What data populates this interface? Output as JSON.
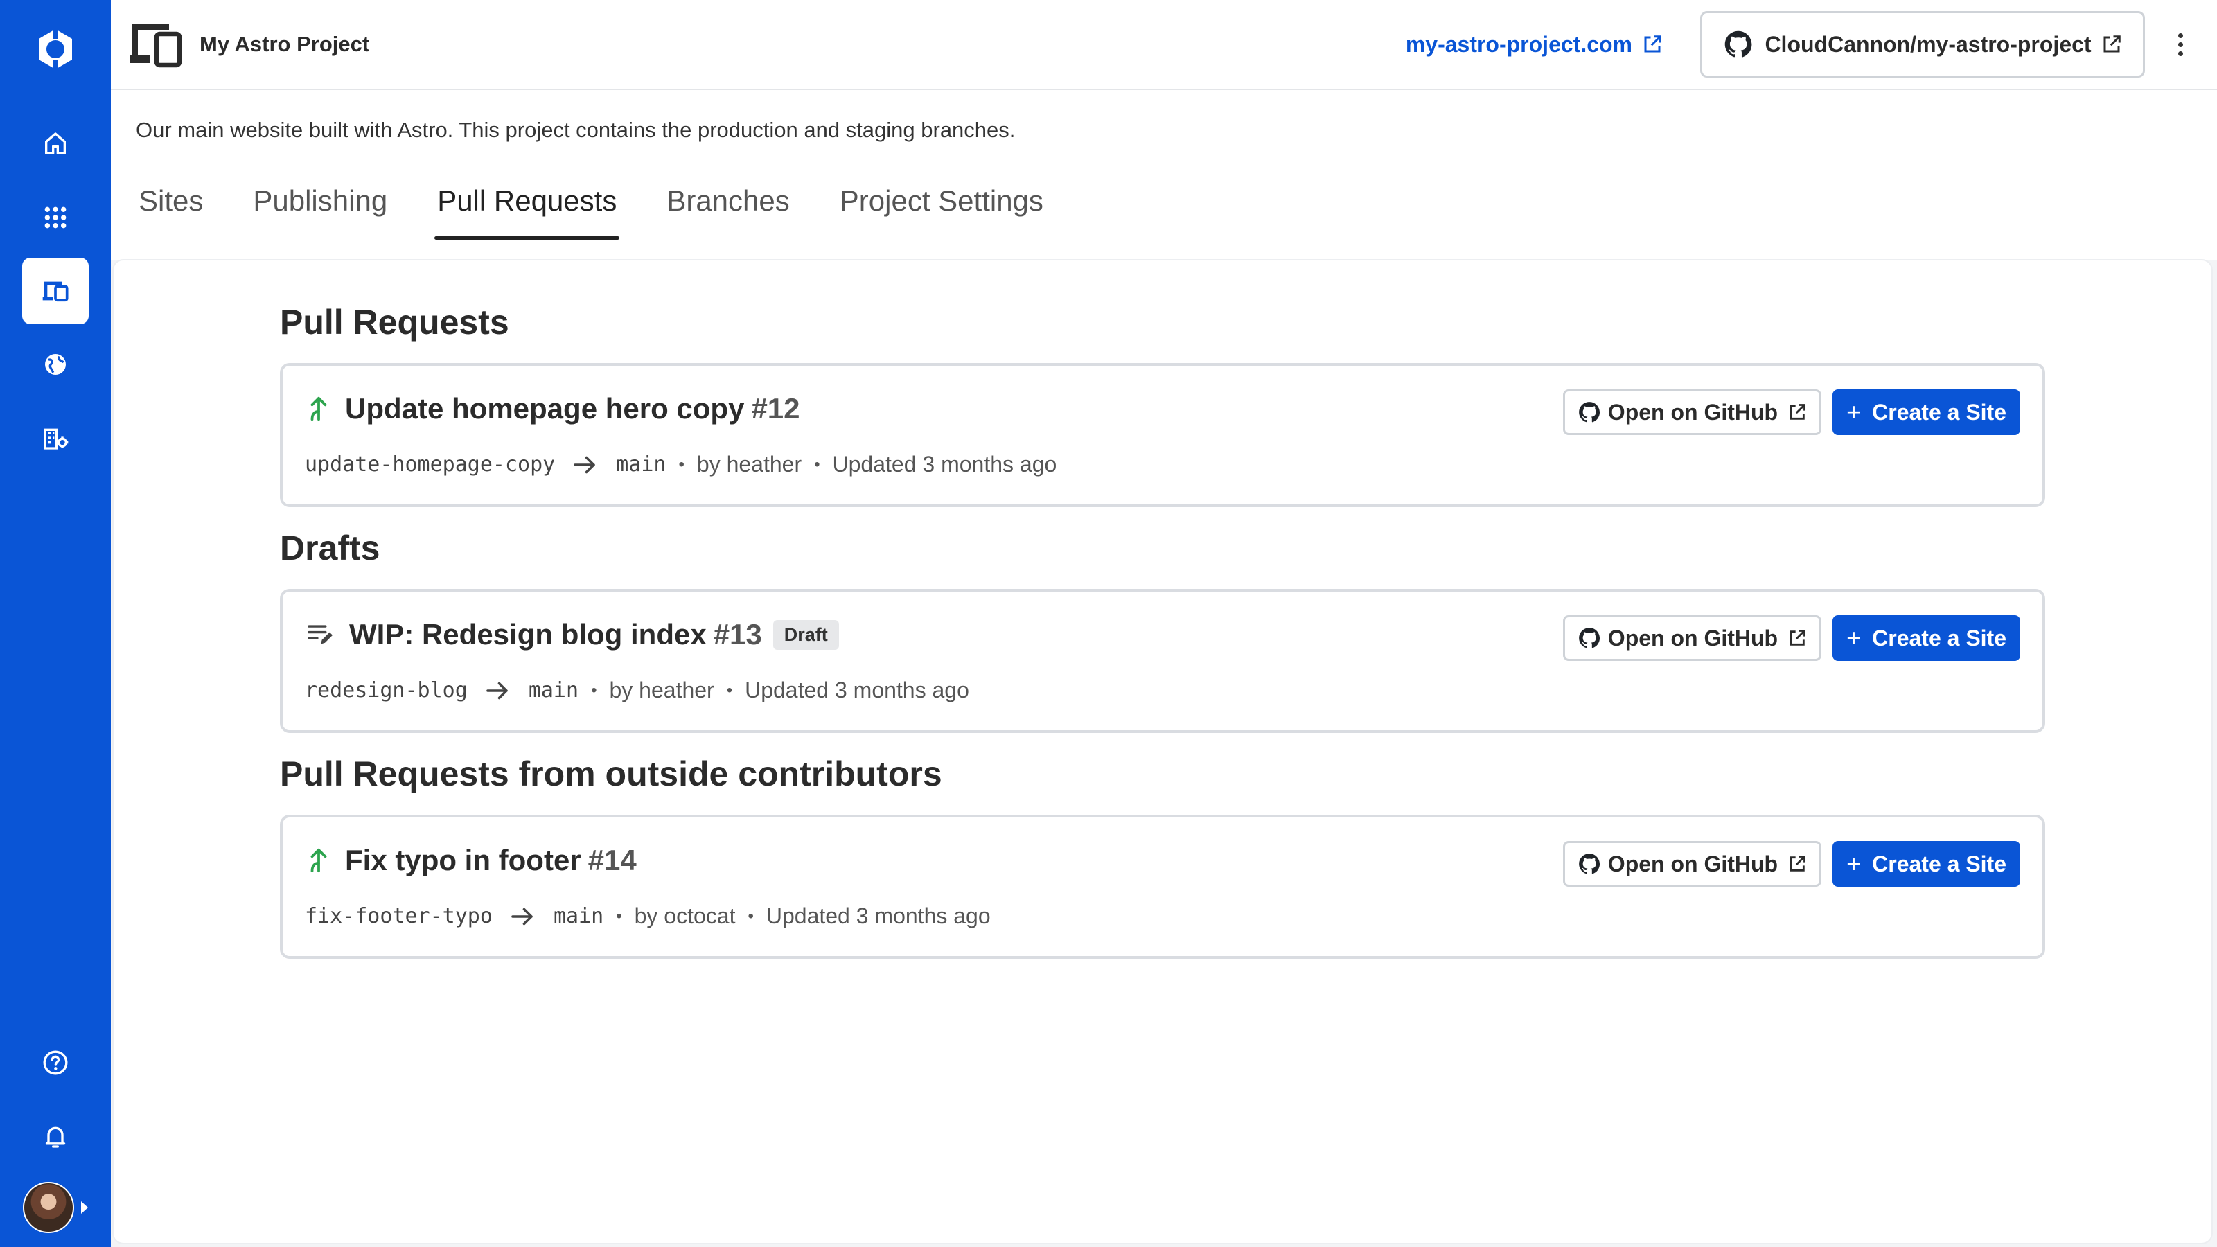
{
  "header": {
    "project_name": "My Astro Project",
    "site_url": "my-astro-project.com",
    "repo": "CloudCannon/my-astro-project"
  },
  "description": "Our main website built with Astro. This project contains the production and staging branches.",
  "tabs": [
    {
      "label": "Sites",
      "active": false
    },
    {
      "label": "Publishing",
      "active": false
    },
    {
      "label": "Pull Requests",
      "active": true
    },
    {
      "label": "Branches",
      "active": false
    },
    {
      "label": "Project Settings",
      "active": false
    }
  ],
  "labels": {
    "open_github": "Open on GitHub",
    "create_site": "Create a Site",
    "plus": "+"
  },
  "sections": [
    {
      "title": "Pull Requests",
      "item": {
        "icon": "pull-request-icon",
        "title": "Update homepage hero copy",
        "number": "#12",
        "badge": "",
        "source_branch": "update-homepage-copy",
        "target_branch": "main",
        "author": "by heather",
        "updated": "Updated 3 months ago"
      }
    },
    {
      "title": "Drafts",
      "item": {
        "icon": "draft-icon",
        "title": "WIP: Redesign blog index",
        "number": "#13",
        "badge": "Draft",
        "source_branch": "redesign-blog",
        "target_branch": "main",
        "author": "by heather",
        "updated": "Updated 3 months ago"
      }
    },
    {
      "title": "Pull Requests from outside contributors",
      "item": {
        "icon": "pull-request-icon",
        "title": "Fix typo in footer",
        "number": "#14",
        "badge": "",
        "source_branch": "fix-footer-typo",
        "target_branch": "main",
        "author": "by octocat",
        "updated": "Updated 3 months ago"
      }
    }
  ],
  "colors": {
    "brand": "#0a55d6",
    "pr_green": "#2da44e",
    "border": "#d9dce1"
  }
}
